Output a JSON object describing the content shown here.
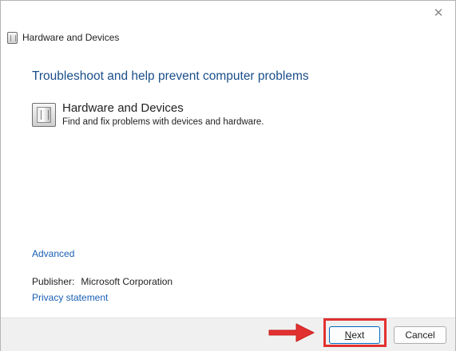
{
  "window": {
    "title": "Hardware and Devices",
    "close_glyph": "✕"
  },
  "main": {
    "heading": "Troubleshoot and help prevent computer problems",
    "item": {
      "title": "Hardware and Devices",
      "description": "Find and fix problems with devices and hardware.",
      "icon": "hardware-icon"
    },
    "advanced_link": "Advanced",
    "publisher_label": "Publisher:",
    "publisher_value": "Microsoft Corporation",
    "privacy_link": "Privacy statement"
  },
  "footer": {
    "next_first": "N",
    "next_rest": "ext",
    "cancel_label": "Cancel"
  },
  "annotation": {
    "highlight_color": "#e23030"
  }
}
